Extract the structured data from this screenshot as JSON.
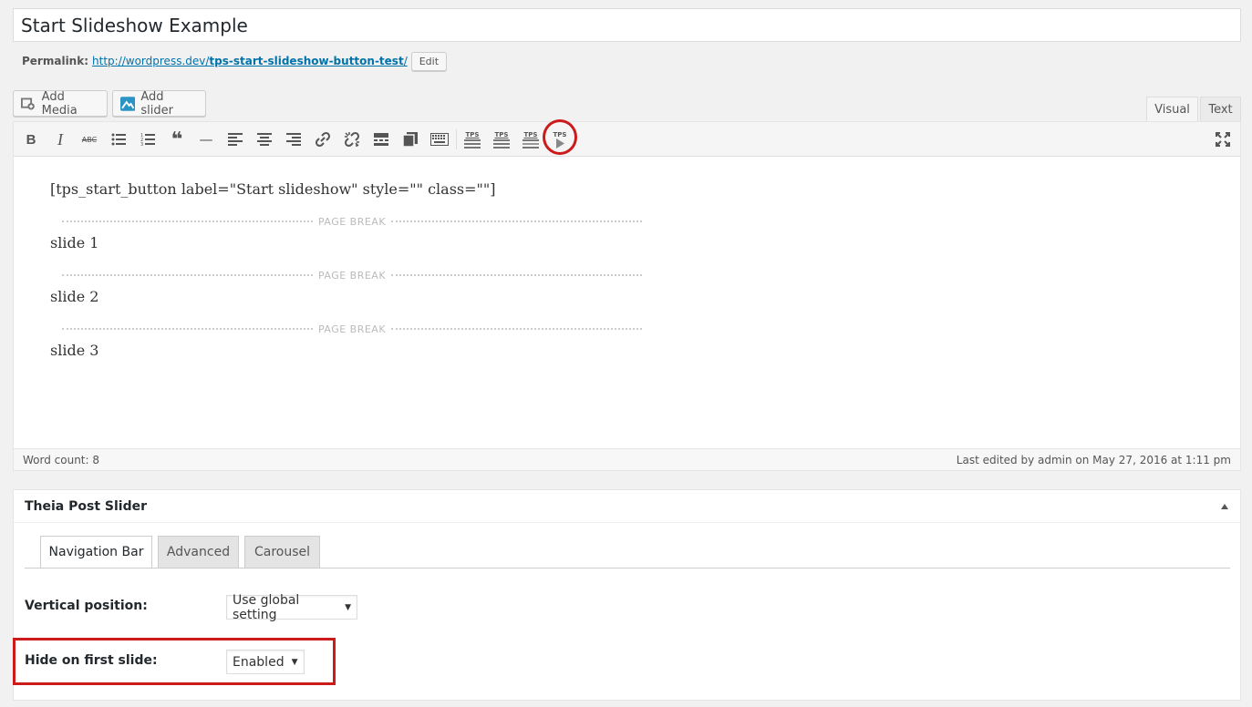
{
  "post": {
    "title": "Start Slideshow Example",
    "permalink_label": "Permalink:",
    "permalink_base": "http://wordpress.dev/",
    "permalink_slug": "tps-start-slideshow-button-test",
    "permalink_trailing": "/",
    "edit_label": "Edit"
  },
  "media": {
    "add_media": "Add Media",
    "add_slider": "Add slider"
  },
  "editor_tabs": {
    "visual": "Visual",
    "text": "Text"
  },
  "toolbar": {
    "items": [
      {
        "name": "bold-icon",
        "glyph": "B"
      },
      {
        "name": "italic-icon",
        "glyph": "I"
      },
      {
        "name": "strikethrough-icon",
        "glyph": "ABC"
      },
      {
        "name": "bulleted-list-icon",
        "glyph": "☰"
      },
      {
        "name": "numbered-list-icon",
        "glyph": "☰"
      },
      {
        "name": "blockquote-icon",
        "glyph": "❝"
      },
      {
        "name": "horizontal-line-icon",
        "glyph": "—"
      },
      {
        "name": "align-left-icon",
        "glyph": "≡"
      },
      {
        "name": "align-center-icon",
        "glyph": "≡"
      },
      {
        "name": "align-right-icon",
        "glyph": "≡"
      },
      {
        "name": "link-icon",
        "glyph": "🔗"
      },
      {
        "name": "unlink-icon",
        "glyph": "⛓"
      },
      {
        "name": "read-more-icon",
        "glyph": "▬"
      },
      {
        "name": "paste-icon",
        "glyph": "❐"
      },
      {
        "name": "keyboard-icon",
        "glyph": "⌨"
      },
      {
        "name": "tps-page-break-icon",
        "glyph": "TPS"
      },
      {
        "name": "tps-page-break-2-icon",
        "glyph": "TPS"
      },
      {
        "name": "tps-page-break-3-icon",
        "glyph": "TPS"
      },
      {
        "name": "tps-start-slideshow-icon",
        "glyph": "TPS"
      }
    ],
    "fullscreen_icon": "fullscreen-icon"
  },
  "content": {
    "shortcode": "[tps_start_button label=\"Start slideshow\" style=\"\" class=\"\"]",
    "page_break_label": "PAGE BREAK",
    "slides": [
      "slide 1",
      "slide 2",
      "slide 3"
    ]
  },
  "status": {
    "word_count": "Word count: 8",
    "last_edited": "Last edited by admin on May 27, 2016 at 1:11 pm"
  },
  "metabox": {
    "title": "Theia Post Slider",
    "tabs": [
      "Navigation Bar",
      "Advanced",
      "Carousel"
    ],
    "fields": {
      "vertical_position_label": "Vertical position:",
      "vertical_position_value": "Use global setting",
      "hide_first_label": "Hide on first slide:",
      "hide_first_value": "Enabled"
    }
  },
  "colors": {
    "link": "#0073aa",
    "highlight": "#cc1b1b"
  }
}
